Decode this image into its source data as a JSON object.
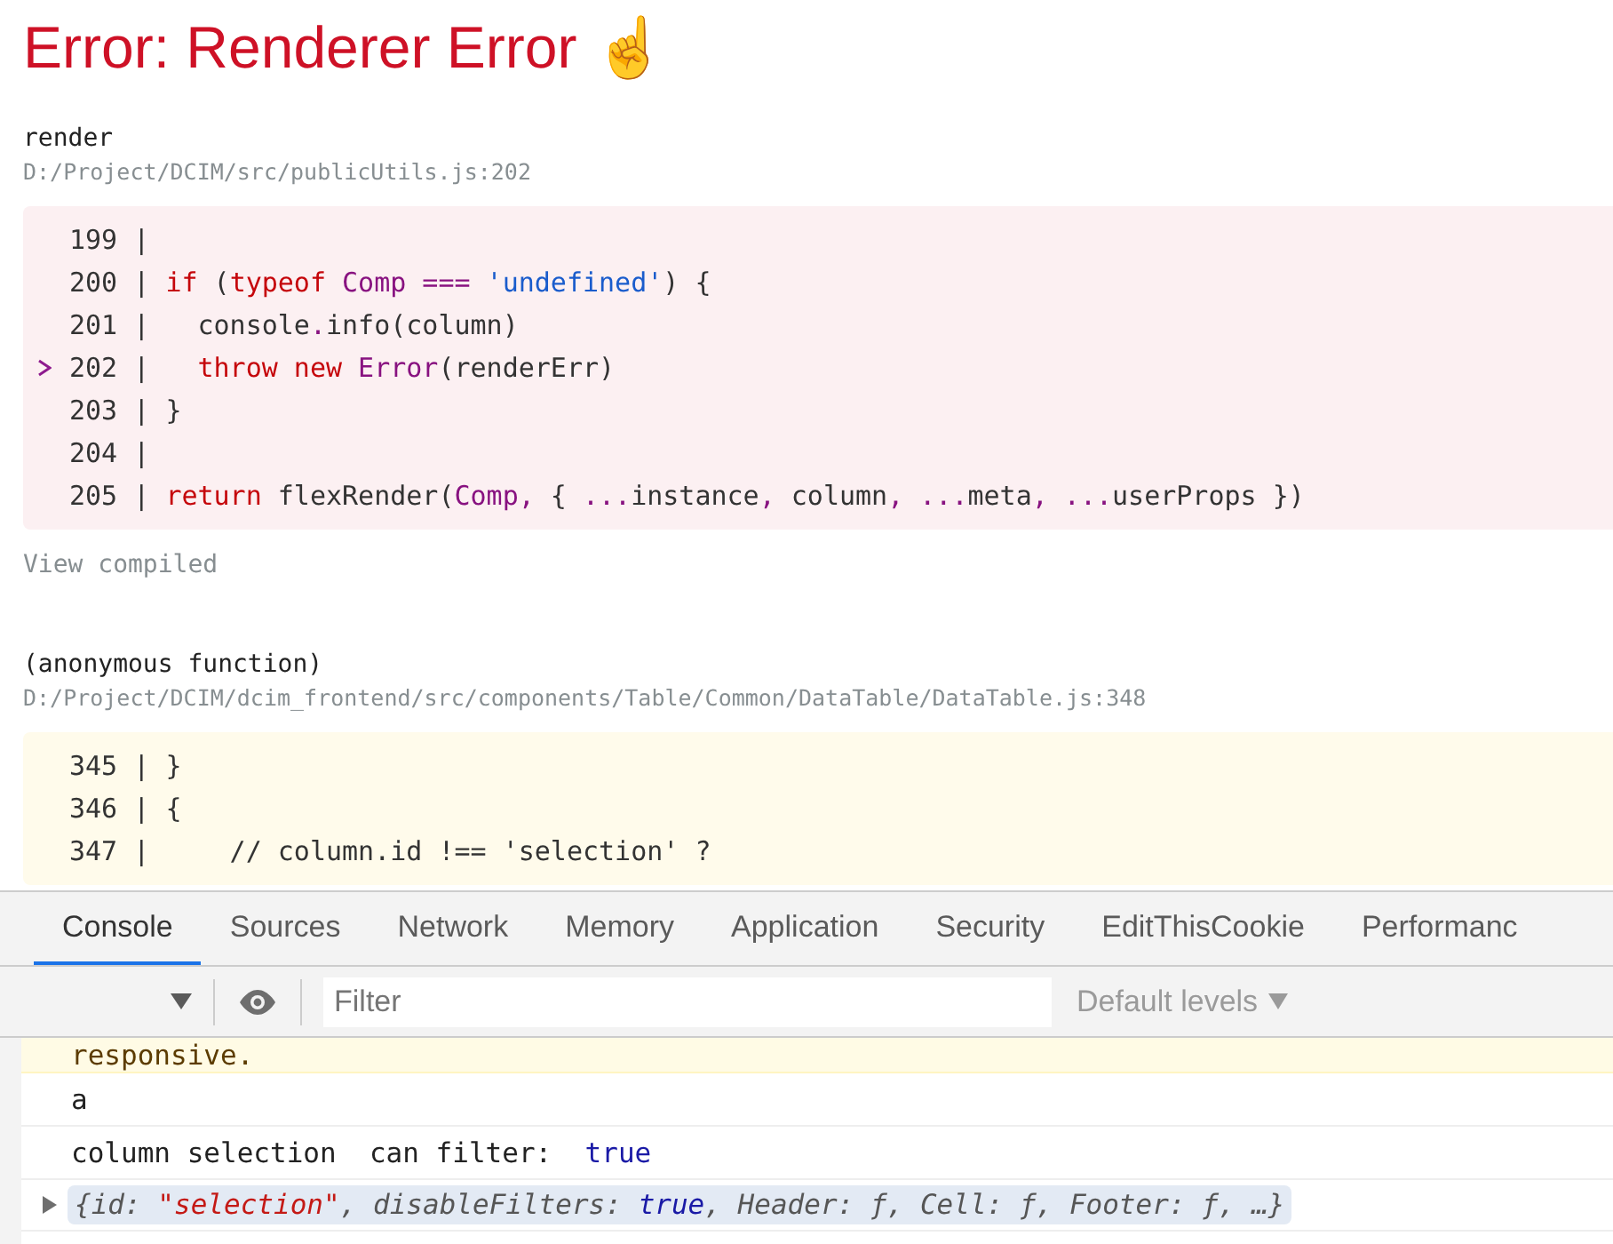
{
  "overlay": {
    "title": "Error: Renderer Error ☝",
    "frames": [
      {
        "function": "render",
        "location": "D:/Project/DCIM/src/publicUtils.js:202",
        "kind": "error",
        "link": "View compiled",
        "lines": [
          {
            "number": "199 |",
            "current": false
          },
          {
            "number": "200 |",
            "current": false,
            "tokens": [
              {
                "kind": "keyword",
                "text": "if"
              },
              {
                "kind": "plain",
                "text": " ("
              },
              {
                "kind": "keyword",
                "text": "typeof"
              },
              {
                "kind": "name",
                "text": " Comp ==="
              },
              {
                "kind": "string",
                "text": " 'undefined'"
              },
              {
                "kind": "plain",
                "text": ") {"
              }
            ]
          },
          {
            "number": "201 |",
            "current": false,
            "tokens": [
              {
                "kind": "plain",
                "text": "  console"
              },
              {
                "kind": "name",
                "text": "."
              },
              {
                "kind": "plain",
                "text": "info(column)"
              }
            ]
          },
          {
            "number": "202 |",
            "current": true,
            "tokens": [
              {
                "kind": "keyword",
                "text": "  throw new"
              },
              {
                "kind": "name",
                "text": " Error"
              },
              {
                "kind": "plain",
                "text": "(renderErr)"
              }
            ]
          },
          {
            "number": "203 |",
            "current": false,
            "tokens": [
              {
                "kind": "plain",
                "text": "}"
              }
            ]
          },
          {
            "number": "204 |",
            "current": false
          },
          {
            "number": "205 |",
            "current": false,
            "tokens": [
              {
                "kind": "keyword",
                "text": "return"
              },
              {
                "kind": "plain",
                "text": " flexRender("
              },
              {
                "kind": "name",
                "text": "Comp,"
              },
              {
                "kind": "plain",
                "text": " { "
              },
              {
                "kind": "name",
                "text": "..."
              },
              {
                "kind": "plain",
                "text": "instance"
              },
              {
                "kind": "name",
                "text": ","
              },
              {
                "kind": "plain",
                "text": " column"
              },
              {
                "kind": "name",
                "text": ", ..."
              },
              {
                "kind": "plain",
                "text": "meta"
              },
              {
                "kind": "name",
                "text": ", ..."
              },
              {
                "kind": "plain",
                "text": "userProps })"
              }
            ]
          }
        ]
      },
      {
        "function": "(anonymous function)",
        "location": "D:/Project/DCIM/dcim_frontend/src/components/Table/Common/DataTable/DataTable.js:348",
        "kind": "warning",
        "lines": [
          {
            "number": "345 |",
            "current": false,
            "tokens": [
              {
                "kind": "plain",
                "text": "}"
              }
            ]
          },
          {
            "number": "346 |",
            "current": false,
            "tokens": [
              {
                "kind": "plain",
                "text": "{"
              }
            ]
          },
          {
            "number": "347 |",
            "current": false,
            "tokens": [
              {
                "kind": "plain",
                "text": "    // column.id !== 'selection' ?"
              }
            ]
          }
        ]
      }
    ]
  },
  "devtools": {
    "tabs": [
      {
        "label": "Console",
        "selected": true
      },
      {
        "label": "Sources",
        "selected": false
      },
      {
        "label": "Network",
        "selected": false
      },
      {
        "label": "Memory",
        "selected": false
      },
      {
        "label": "Application",
        "selected": false
      },
      {
        "label": "Security",
        "selected": false
      },
      {
        "label": "EditThisCookie",
        "selected": false
      },
      {
        "label": "Performanc",
        "selected": false
      }
    ],
    "filter": {
      "placeholder": "Filter"
    },
    "levels": "Default levels",
    "messages": [
      {
        "kind": "warning",
        "tokens": [
          {
            "kind": "plain",
            "text": "responsive."
          }
        ]
      },
      {
        "kind": "log",
        "tokens": [
          {
            "kind": "plain",
            "text": "a"
          }
        ]
      },
      {
        "kind": "log",
        "tokens": [
          {
            "kind": "plain",
            "text": "column selection  can filter:  "
          },
          {
            "kind": "boolean",
            "text": "true"
          }
        ]
      },
      {
        "kind": "object",
        "tokens": [
          {
            "kind": "key",
            "text": "{id: "
          },
          {
            "kind": "string",
            "text": "\"selection\""
          },
          {
            "kind": "key",
            "text": ", disableFilters: "
          },
          {
            "kind": "boolean",
            "text": "true"
          },
          {
            "kind": "key",
            "text": ", Header: ƒ, Cell: ƒ, Footer: ƒ, …}"
          }
        ]
      }
    ]
  }
}
